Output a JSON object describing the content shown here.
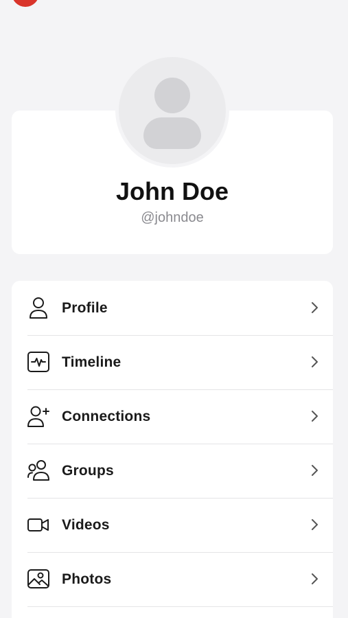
{
  "colors": {
    "background": "#f4f4f6",
    "card": "#ffffff",
    "accent_badge": "#d9342b",
    "handle_text": "#8a8a8f",
    "avatar_placeholder": "#d2d2d5"
  },
  "profile": {
    "name": "John Doe",
    "handle": "@johndoe",
    "avatar_icon": "user-placeholder-icon"
  },
  "menu": {
    "items": [
      {
        "label": "Profile",
        "icon": "user-icon"
      },
      {
        "label": "Timeline",
        "icon": "activity-icon"
      },
      {
        "label": "Connections",
        "icon": "user-plus-icon"
      },
      {
        "label": "Groups",
        "icon": "users-icon"
      },
      {
        "label": "Videos",
        "icon": "video-icon"
      },
      {
        "label": "Photos",
        "icon": "image-icon"
      }
    ],
    "chevron_icon": "chevron-right-icon"
  }
}
